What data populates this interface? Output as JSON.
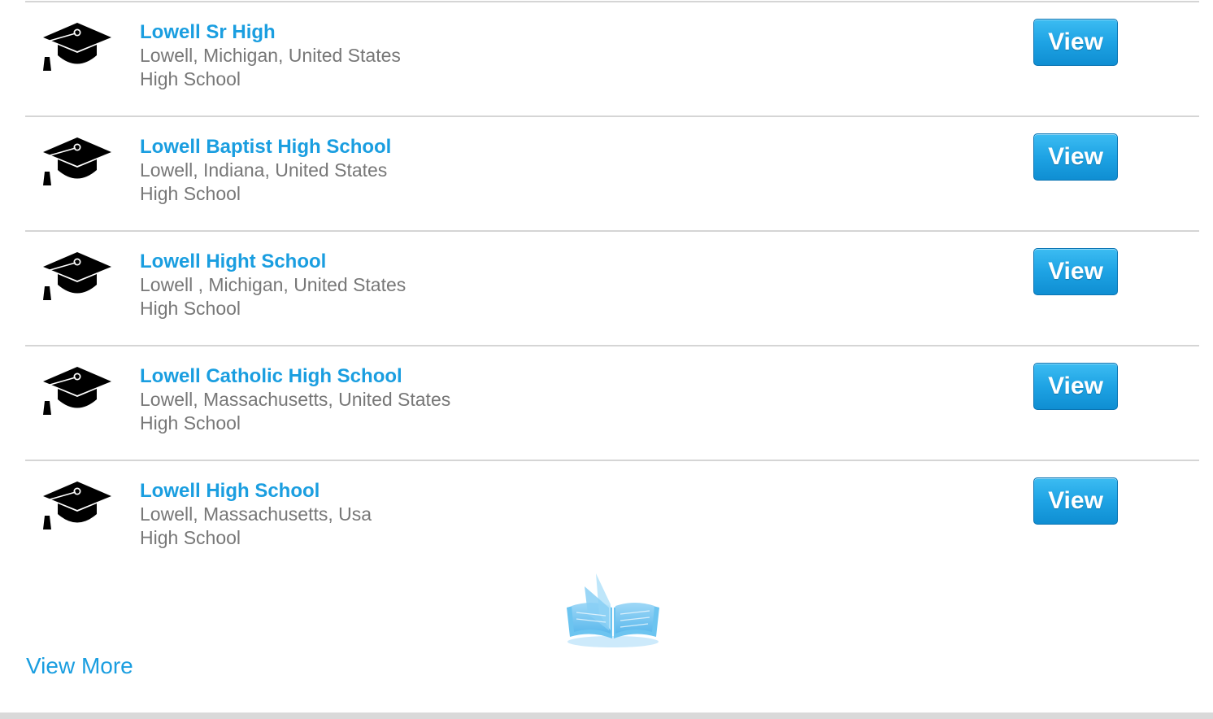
{
  "schools": [
    {
      "name": "Lowell Sr High",
      "location": "Lowell, Michigan, United States",
      "type": "High School",
      "button": "View"
    },
    {
      "name": "Lowell Baptist High School",
      "location": "Lowell, Indiana, United States",
      "type": "High School",
      "button": "View"
    },
    {
      "name": "Lowell Hight School",
      "location": "Lowell , Michigan, United States",
      "type": "High School",
      "button": "View"
    },
    {
      "name": "Lowell Catholic High School",
      "location": "Lowell, Massachusetts, United States",
      "type": "High School",
      "button": "View"
    },
    {
      "name": "Lowell High School",
      "location": "Lowell, Massachusetts, Usa",
      "type": "High School",
      "button": "View"
    }
  ],
  "row_icon": "graduation-cap-icon",
  "loading_icon": "open-book-icon",
  "view_more_label": "View More",
  "colors": {
    "link": "#1a9ee0",
    "secondary_text": "#777777",
    "button": "#1ea3e4",
    "divider": "#d5d5d5"
  }
}
